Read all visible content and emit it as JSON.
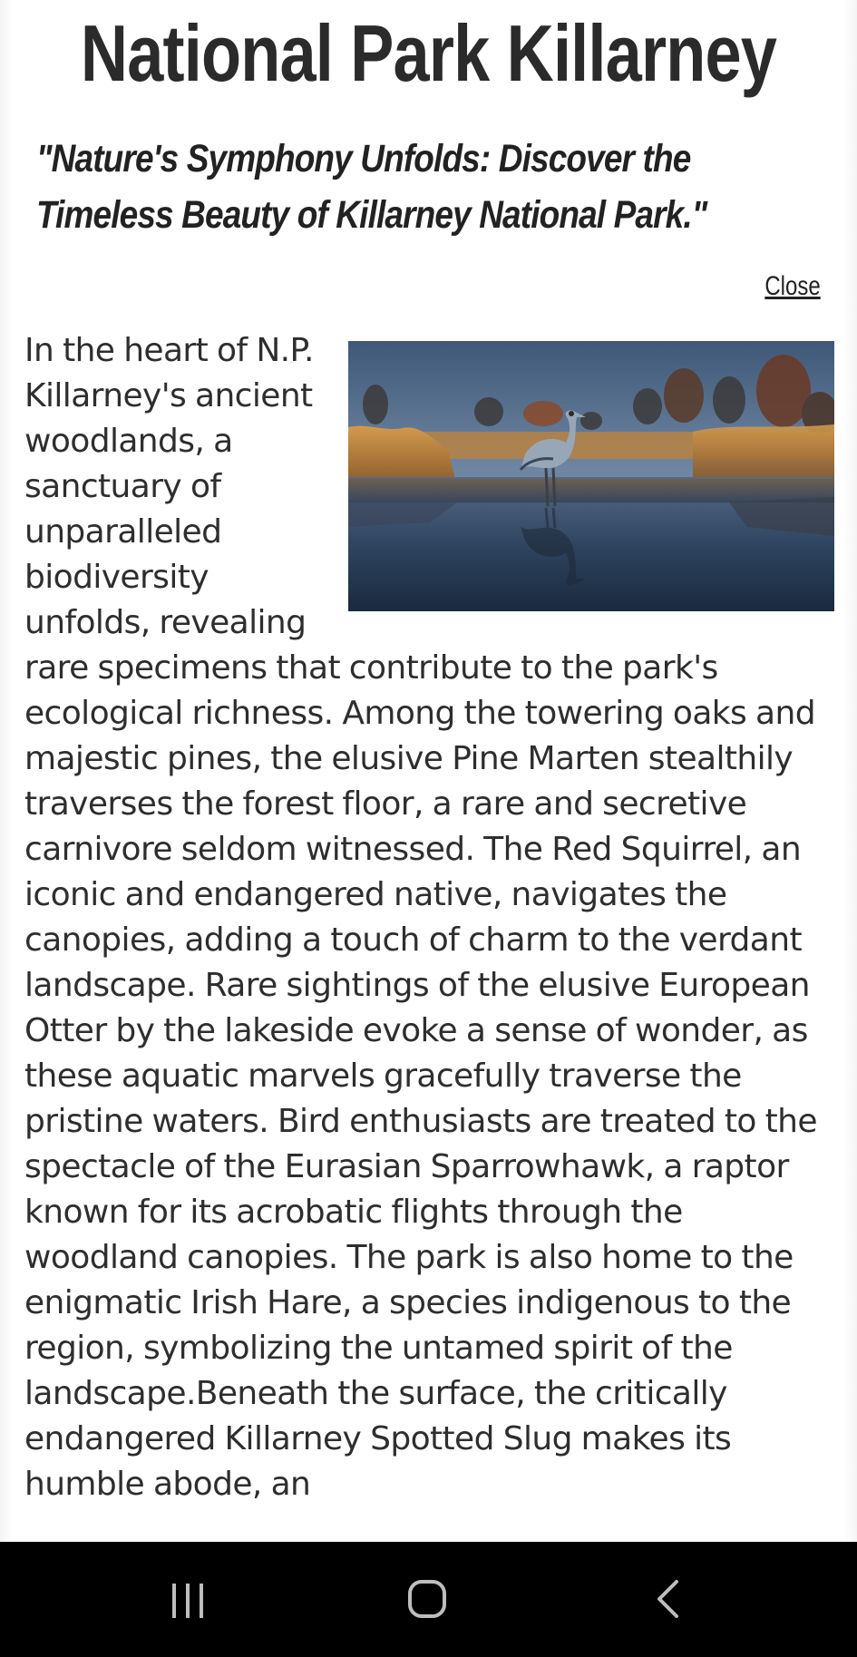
{
  "header": {
    "title": "National Park Killarney",
    "tagline": "\"Nature's Symphony Unfolds: Discover the Timeless Beauty of Killarney National Park.\"",
    "close_label": "Close"
  },
  "article": {
    "text": "In the heart of N.P. Killarney's ancient woodlands, a sanctuary of unparalleled biodiversity unfolds, revealing rare specimens that contribute to the park's ecological richness. Among the towering oaks and majestic pines, the elusive Pine Marten stealthily traverses the forest floor, a rare and secretive carnivore seldom witnessed. The Red Squirrel, an iconic and endangered native, navigates the canopies, adding a touch of charm to the verdant landscape. Rare sightings of the elusive European Otter by the lakeside evoke a sense of wonder, as these aquatic marvels gracefully traverse the pristine waters. Bird enthusiasts are treated to the spectacle of the Eurasian Sparrowhawk, a raptor known for its acrobatic flights through the woodland canopies. The park is also home to the enigmatic Irish Hare, a species indigenous to the region, symbolizing the untamed spirit of the landscape.Beneath the surface, the critically endangered Killarney Spotted Slug makes its humble abode, an",
    "image": {
      "subject": "crane-wading-in-lake-photo"
    }
  },
  "navigation_bar": {
    "buttons": [
      {
        "name": "recent-apps",
        "icon": "recent-apps-icon"
      },
      {
        "name": "home",
        "icon": "home-icon"
      },
      {
        "name": "back",
        "icon": "back-icon"
      }
    ],
    "background": "#000000",
    "icon_color": "#bdbdbd"
  },
  "colors": {
    "title": "#2b2b2b",
    "text": "#2e2e2e",
    "page_background": "#ffffff"
  }
}
